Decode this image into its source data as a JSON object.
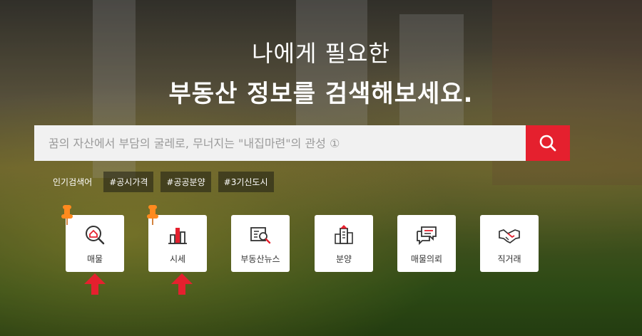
{
  "hero": {
    "line1": "나에게 필요한",
    "line2": "부동산 정보를 검색해보세요."
  },
  "search": {
    "placeholder": "꿈의 자산에서 부담의 굴레로, 무너지는 \"내집마련\"의 관성 ①",
    "button_icon": "search-icon"
  },
  "popular": {
    "label": "인기검색어",
    "tags": [
      "#공시가격",
      "#공공분양",
      "#3기신도시"
    ]
  },
  "menu": [
    {
      "label": "매물",
      "icon": "house-search-icon"
    },
    {
      "label": "시세",
      "icon": "bar-chart-icon"
    },
    {
      "label": "부동산뉴스",
      "icon": "newspaper-search-icon"
    },
    {
      "label": "분양",
      "icon": "building-icon"
    },
    {
      "label": "매물의뢰",
      "icon": "chat-bubbles-icon"
    },
    {
      "label": "직거래",
      "icon": "handshake-icon"
    }
  ],
  "colors": {
    "accent": "#e5202e",
    "pin": "#ff8a1e"
  },
  "annotations": {
    "pins_on": [
      "매물",
      "시세"
    ],
    "arrows_on": [
      "매물",
      "시세"
    ]
  }
}
